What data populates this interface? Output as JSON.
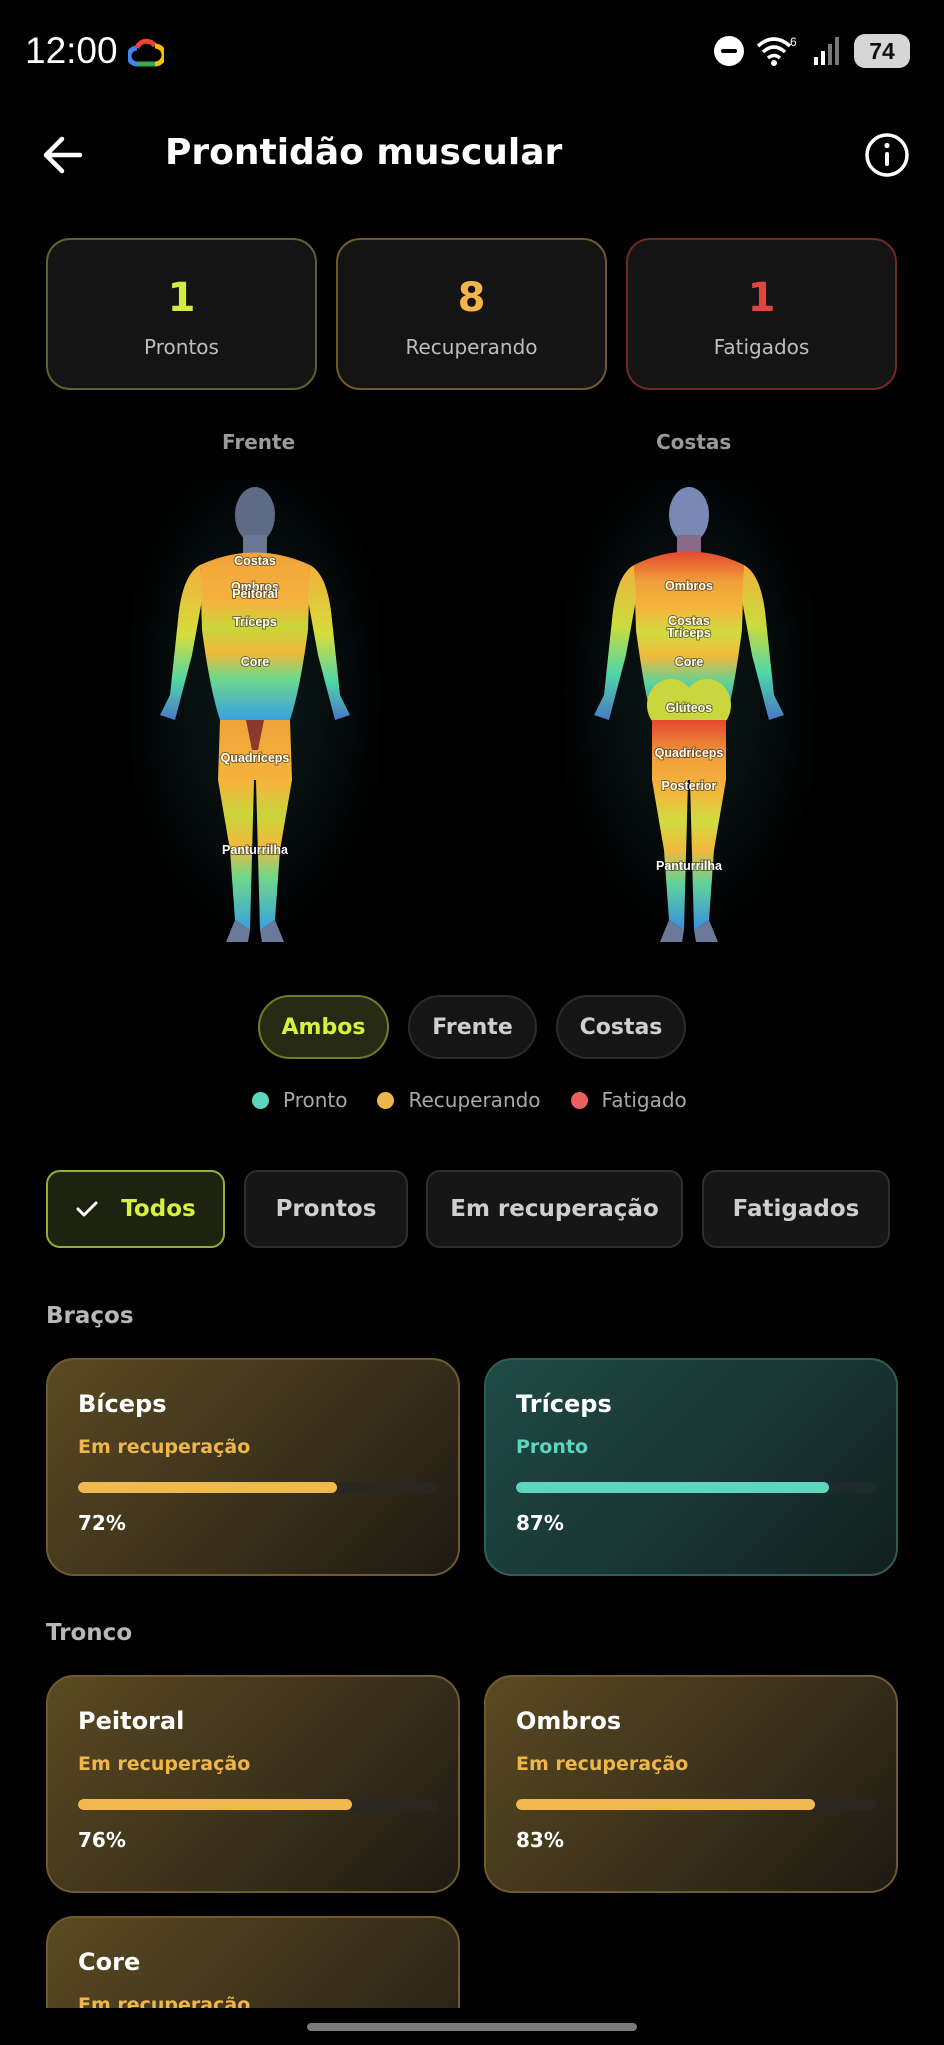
{
  "status_bar": {
    "time": "12:00",
    "wifi_badge": "6",
    "battery": "74"
  },
  "header": {
    "title": "Prontidão muscular",
    "back_icon": "arrow-left-icon",
    "info_icon": "info-circle-icon"
  },
  "summary": [
    {
      "count": "1",
      "label": "Prontos",
      "color": "#d4ec3e"
    },
    {
      "count": "8",
      "label": "Recuperando",
      "color": "#f3b54a"
    },
    {
      "count": "1",
      "label": "Fatigados",
      "color": "#e5433d"
    }
  ],
  "figures": {
    "front": {
      "title": "Frente",
      "labels": [
        "Costas",
        "Ombros",
        "Peitoral",
        "Tríceps",
        "Core",
        "Quadríceps",
        "Panturrilha"
      ]
    },
    "back": {
      "title": "Costas",
      "labels": [
        "Ombros",
        "Costas",
        "Tríceps",
        "Core",
        "Glúteos",
        "Quadríceps",
        "Posterior",
        "Panturrilha"
      ]
    }
  },
  "view_toggle": {
    "options": [
      "Ambos",
      "Frente",
      "Costas"
    ],
    "selected": "Ambos"
  },
  "legend": [
    {
      "label": "Pronto",
      "color": "#5ed5bf"
    },
    {
      "label": "Recuperando",
      "color": "#efb64c"
    },
    {
      "label": "Fatigado",
      "color": "#ec5f5b"
    }
  ],
  "filters": {
    "options": [
      "Todos",
      "Prontos",
      "Em recuperação",
      "Fatigados"
    ],
    "selected": "Todos"
  },
  "sections": [
    {
      "title": "Braços",
      "muscles": [
        {
          "name": "Bíceps",
          "status": "Em recuperação",
          "percent": "72%",
          "value": 72,
          "state": "recovering"
        },
        {
          "name": "Tríceps",
          "status": "Pronto",
          "percent": "87%",
          "value": 87,
          "state": "ready"
        }
      ]
    },
    {
      "title": "Tronco",
      "muscles": [
        {
          "name": "Peitoral",
          "status": "Em recuperação",
          "percent": "76%",
          "value": 76,
          "state": "recovering"
        },
        {
          "name": "Ombros",
          "status": "Em recuperação",
          "percent": "83%",
          "value": 83,
          "state": "recovering"
        },
        {
          "name": "Core",
          "status": "Em recuperação",
          "percent": "",
          "value": null,
          "state": "recovering"
        }
      ]
    }
  ]
}
